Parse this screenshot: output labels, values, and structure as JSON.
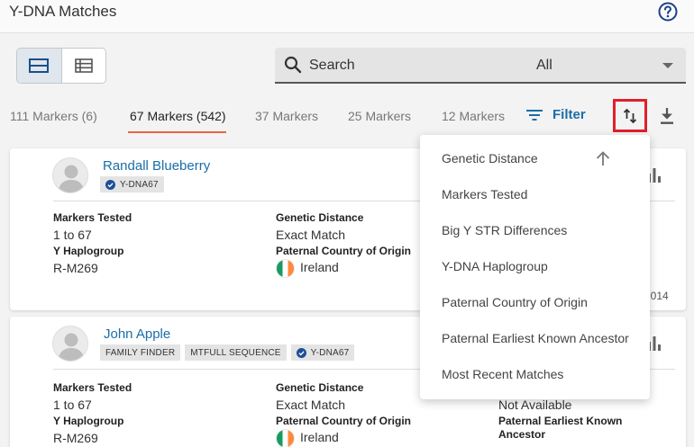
{
  "header": {
    "title": "Y-DNA Matches"
  },
  "search": {
    "placeholder": "Search",
    "select_value": "All"
  },
  "tabs": [
    {
      "label": "111 Markers (6)"
    },
    {
      "label": "67 Markers (542)"
    },
    {
      "label": "37 Markers"
    },
    {
      "label": "25 Markers"
    },
    {
      "label": "12 Markers"
    }
  ],
  "toolbar": {
    "filter_label": "Filter"
  },
  "sort_menu": {
    "items": [
      "Genetic Distance",
      "Markers Tested",
      "Big Y STR Differences",
      "Y-DNA Haplogroup",
      "Paternal Country of Origin",
      "Paternal Earliest Known Ancestor",
      "Most Recent Matches"
    ]
  },
  "matches": [
    {
      "name": "Randall Blueberry",
      "badges": [
        "Y-DNA67"
      ],
      "markers_tested_label": "Markers Tested",
      "markers_tested": "1 to 67",
      "haplogroup_label": "Y Haplogroup",
      "haplogroup": "R-M269",
      "genetic_distance_label": "Genetic Distance",
      "genetic_distance": "Exact Match",
      "country_label": "Paternal Country of Origin",
      "country": "Ireland",
      "date_fragment": "2014"
    },
    {
      "name": "John Apple",
      "badges": [
        "FAMILY FINDER",
        "MTFULL SEQUENCE",
        "Y-DNA67"
      ],
      "markers_tested_label": "Markers Tested",
      "markers_tested": "1 to 67",
      "haplogroup_label": "Y Haplogroup",
      "haplogroup": "R-M269",
      "genetic_distance_label": "Genetic Distance",
      "genetic_distance": "Exact Match",
      "country_label": "Paternal Country of Origin",
      "country": "Ireland",
      "extra_value": "Not Available",
      "ancestor_label_line1": "Paternal Earliest Known",
      "ancestor_label_line2": "Ancestor"
    }
  ],
  "colors": {
    "link": "#1a6ea8",
    "active_tab_underline": "#e8654a",
    "highlight_box": "#e0202a"
  }
}
